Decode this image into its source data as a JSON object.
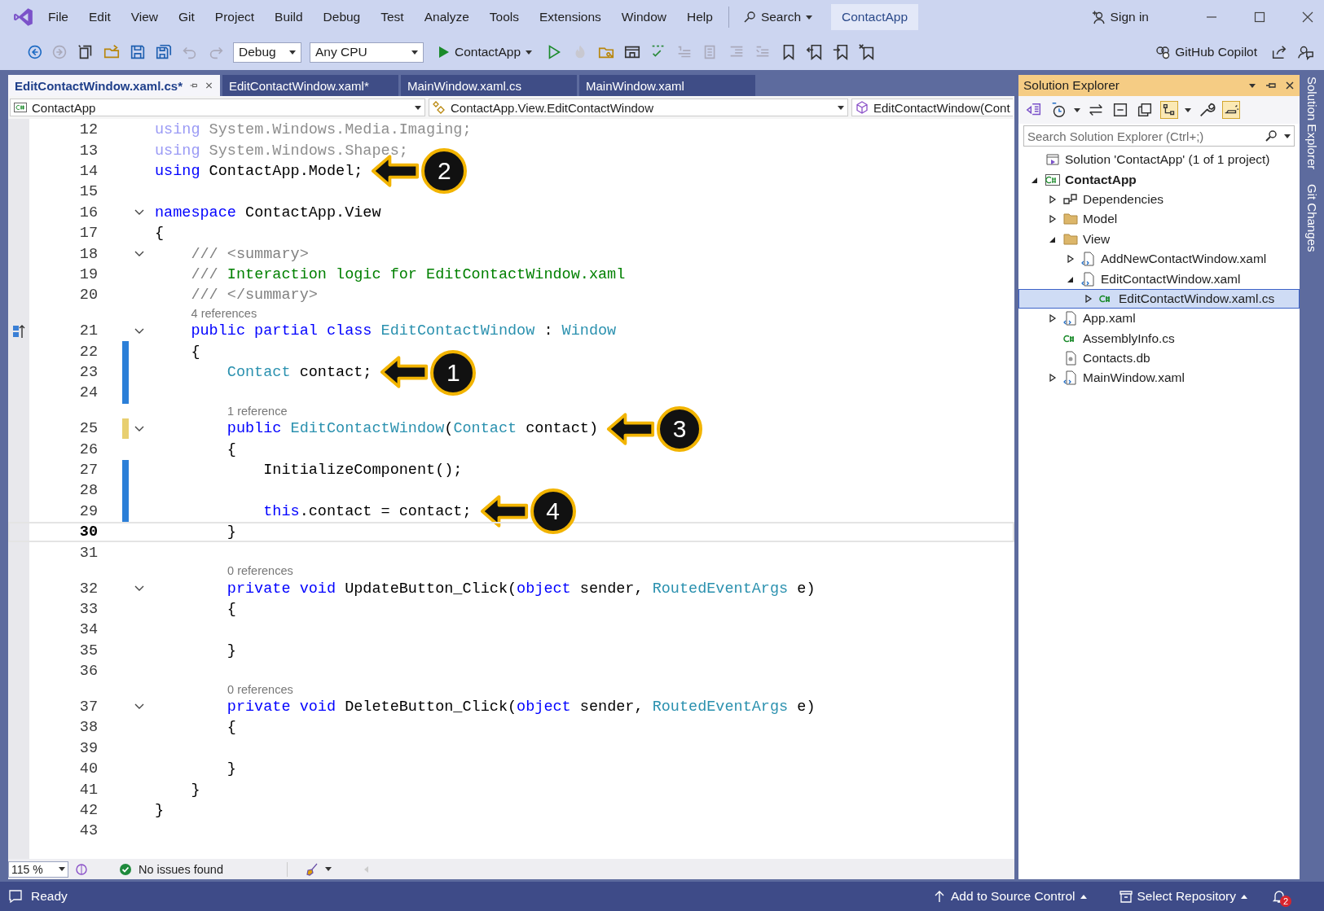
{
  "title_bar": {
    "menu": [
      "File",
      "Edit",
      "View",
      "Git",
      "Project",
      "Build",
      "Debug",
      "Test",
      "Analyze",
      "Tools",
      "Extensions",
      "Window",
      "Help"
    ],
    "search": "Search",
    "title": "ContactApp",
    "sign_in": "Sign in"
  },
  "toolbar": {
    "configuration": "Debug",
    "platform": "Any CPU",
    "run_target": "ContactApp",
    "copilot": "GitHub Copilot"
  },
  "tabs": [
    {
      "label": "EditContactWindow.xaml.cs*",
      "selected": true
    },
    {
      "label": "EditContactWindow.xaml*",
      "selected": false
    },
    {
      "label": "MainWindow.xaml.cs",
      "selected": false
    },
    {
      "label": "MainWindow.xaml",
      "selected": false
    }
  ],
  "nav_bar": {
    "project": "ContactApp",
    "type": "ContactApp.View.EditContactWindow",
    "member": "EditContactWindow(Cont"
  },
  "editor": {
    "lines": [
      {
        "kind": "code",
        "n": "12",
        "current": false,
        "tokens": [
          {
            "kind": "faded_keyword",
            "text": "using"
          },
          {
            "kind": "faded",
            "text": " System.Windows.Media.Imaging;"
          }
        ]
      },
      {
        "kind": "code",
        "n": "13",
        "current": false,
        "tokens": [
          {
            "kind": "faded_keyword",
            "text": "using"
          },
          {
            "kind": "faded",
            "text": " System.Windows.Shapes;"
          }
        ]
      },
      {
        "kind": "code",
        "n": "14",
        "current": false,
        "callout": "2",
        "tokens": [
          {
            "kind": "keyword",
            "text": "using"
          },
          {
            "kind": "plain",
            "text": " ContactApp.Model;"
          }
        ]
      },
      {
        "kind": "code",
        "n": "15",
        "current": false
      },
      {
        "kind": "code",
        "n": "16",
        "fold": true,
        "current": false,
        "tokens": [
          {
            "kind": "keyword",
            "text": "namespace"
          },
          {
            "kind": "plain",
            "text": " ContactApp.View"
          }
        ]
      },
      {
        "kind": "code",
        "n": "17",
        "current": false,
        "tokens": [
          {
            "kind": "plain",
            "text": "{"
          }
        ]
      },
      {
        "kind": "code",
        "n": "18",
        "fold": true,
        "current": false,
        "tokens": [
          {
            "kind": "doc",
            "text": "    /// <summary>"
          }
        ]
      },
      {
        "kind": "code",
        "n": "19",
        "current": false,
        "tokens": [
          {
            "kind": "doc",
            "text": "    /// "
          },
          {
            "kind": "comment",
            "text": "Interaction logic for EditContactWindow.xaml"
          }
        ]
      },
      {
        "kind": "code",
        "n": "20",
        "current": false,
        "tokens": [
          {
            "kind": "doc",
            "text": "    /// </summary>"
          }
        ]
      },
      {
        "kind": "lens",
        "text": "4 references"
      },
      {
        "kind": "code",
        "n": "21",
        "fold": true,
        "current": false,
        "glyph": true,
        "tokens": [
          {
            "kind": "keyword",
            "text": "    public partial class"
          },
          {
            "kind": "type",
            "text": " EditContactWindow"
          },
          {
            "kind": "plain",
            "text": " : "
          },
          {
            "kind": "type",
            "text": "Window"
          }
        ]
      },
      {
        "kind": "code",
        "n": "22",
        "current": false,
        "color": "#2b7fd8",
        "tokens": [
          {
            "kind": "plain",
            "text": "    {"
          }
        ]
      },
      {
        "kind": "code",
        "n": "23",
        "current": false,
        "color": "#2b7fd8",
        "callout": "1",
        "tokens": [
          {
            "kind": "type",
            "text": "        Contact"
          },
          {
            "kind": "plain",
            "text": " contact;"
          }
        ]
      },
      {
        "kind": "code",
        "n": "24",
        "current": false,
        "color": "#2b7fd8"
      },
      {
        "kind": "lens",
        "text": "1 reference"
      },
      {
        "kind": "code",
        "n": "25",
        "fold": true,
        "current": false,
        "color": "#e8cf70",
        "callout": "3",
        "tokens": [
          {
            "kind": "keyword",
            "text": "        public"
          },
          {
            "kind": "type",
            "text": " EditContactWindow"
          },
          {
            "kind": "plain",
            "text": "("
          },
          {
            "kind": "type",
            "text": "Contact"
          },
          {
            "kind": "plain",
            "text": " contact)"
          }
        ]
      },
      {
        "kind": "code",
        "n": "26",
        "current": false,
        "tokens": [
          {
            "kind": "plain",
            "text": "        {"
          }
        ]
      },
      {
        "kind": "code",
        "n": "27",
        "current": false,
        "color": "#2b7fd8",
        "tokens": [
          {
            "kind": "plain",
            "text": "            InitializeComponent();"
          }
        ]
      },
      {
        "kind": "code",
        "n": "28",
        "current": false,
        "color": "#2b7fd8"
      },
      {
        "kind": "code",
        "n": "29",
        "current": false,
        "color": "#2b7fd8",
        "callout": "4",
        "tokens": [
          {
            "kind": "keyword",
            "text": "            this"
          },
          {
            "kind": "plain",
            "text": ".contact = contact;"
          }
        ]
      },
      {
        "kind": "code",
        "n": "30",
        "current": true,
        "tokens": [
          {
            "kind": "plain",
            "text": "        }"
          }
        ]
      },
      {
        "kind": "code",
        "n": "31",
        "current": false
      },
      {
        "kind": "lens",
        "text": "0 references"
      },
      {
        "kind": "code",
        "n": "32",
        "fold": true,
        "current": false,
        "tokens": [
          {
            "kind": "keyword",
            "text": "        private void"
          },
          {
            "kind": "plain",
            "text": " UpdateButton_Click("
          },
          {
            "kind": "keyword",
            "text": "object"
          },
          {
            "kind": "plain",
            "text": " sender, "
          },
          {
            "kind": "type",
            "text": "RoutedEventArgs"
          },
          {
            "kind": "plain",
            "text": " e)"
          }
        ]
      },
      {
        "kind": "code",
        "n": "33",
        "current": false,
        "tokens": [
          {
            "kind": "plain",
            "text": "        {"
          }
        ]
      },
      {
        "kind": "code",
        "n": "34",
        "current": false
      },
      {
        "kind": "code",
        "n": "35",
        "current": false,
        "tokens": [
          {
            "kind": "plain",
            "text": "        }"
          }
        ]
      },
      {
        "kind": "code",
        "n": "36",
        "current": false
      },
      {
        "kind": "lens",
        "text": "0 references"
      },
      {
        "kind": "code",
        "n": "37",
        "fold": true,
        "current": false,
        "tokens": [
          {
            "kind": "keyword",
            "text": "        private void"
          },
          {
            "kind": "plain",
            "text": " DeleteButton_Click("
          },
          {
            "kind": "keyword",
            "text": "object"
          },
          {
            "kind": "plain",
            "text": " sender, "
          },
          {
            "kind": "type",
            "text": "RoutedEventArgs"
          },
          {
            "kind": "plain",
            "text": " e)"
          }
        ]
      },
      {
        "kind": "code",
        "n": "38",
        "current": false,
        "tokens": [
          {
            "kind": "plain",
            "text": "        {"
          }
        ]
      },
      {
        "kind": "code",
        "n": "39",
        "current": false
      },
      {
        "kind": "code",
        "n": "40",
        "current": false,
        "tokens": [
          {
            "kind": "plain",
            "text": "        }"
          }
        ]
      },
      {
        "kind": "code",
        "n": "41",
        "current": false,
        "tokens": [
          {
            "kind": "plain",
            "text": "    }"
          }
        ]
      },
      {
        "kind": "code",
        "n": "42",
        "current": false,
        "tokens": [
          {
            "kind": "plain",
            "text": "}"
          }
        ]
      },
      {
        "kind": "code",
        "n": "43",
        "current": false
      }
    ],
    "zoom": "115 %",
    "issues": "No issues found"
  },
  "solution_explorer": {
    "title": "Solution Explorer",
    "search": {
      "placeholder": "Search Solution Explorer (Ctrl+;)"
    },
    "tree": [
      {
        "label": "Solution 'ContactApp' (1 of 1 project)",
        "kind": "solution",
        "selected": false
      },
      {
        "label": "ContactApp",
        "kind": "project",
        "selected": false,
        "expanded": true,
        "children": [
          {
            "label": "Dependencies",
            "kind": "dependencies",
            "selected": false,
            "expanded": false
          },
          {
            "label": "Model",
            "kind": "folder",
            "selected": false,
            "expanded": false
          },
          {
            "label": "View",
            "kind": "folder",
            "selected": false,
            "expanded": true,
            "children": [
              {
                "label": "AddNewContactWindow.xaml",
                "kind": "xaml",
                "selected": false,
                "expanded": false
              },
              {
                "label": "EditContactWindow.xaml",
                "kind": "xaml",
                "selected": false,
                "expanded": true,
                "children": [
                  {
                    "label": "EditContactWindow.xaml.cs",
                    "kind": "cs",
                    "selected": true,
                    "expanded": false
                  }
                ]
              }
            ]
          },
          {
            "label": "App.xaml",
            "kind": "xaml",
            "selected": false,
            "expanded": false
          },
          {
            "label": "AssemblyInfo.cs",
            "kind": "cs",
            "selected": false
          },
          {
            "label": "Contacts.db",
            "kind": "file",
            "selected": false
          },
          {
            "label": "MainWindow.xaml",
            "kind": "xaml",
            "selected": false,
            "expanded": false
          }
        ]
      }
    ]
  },
  "side_tabs": [
    "Solution Explorer",
    "Git Changes"
  ],
  "status_bar": {
    "state": "Ready",
    "source_control": "Add to Source Control",
    "repository": "Select Repository",
    "notifications": "2"
  }
}
